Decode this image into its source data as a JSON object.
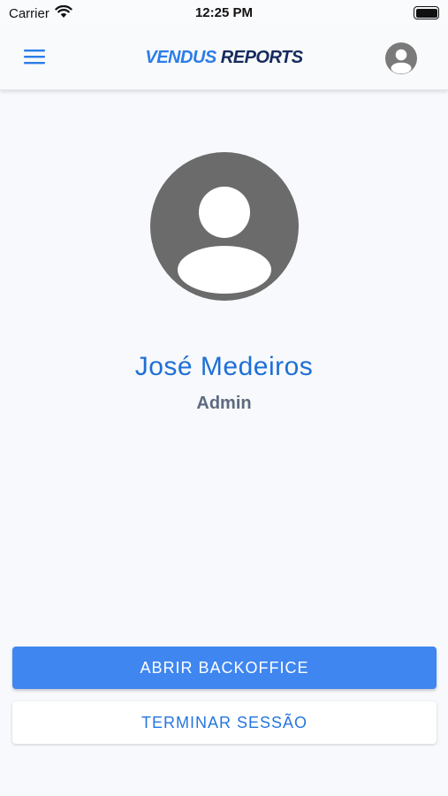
{
  "status_bar": {
    "carrier": "Carrier",
    "time": "12:25 PM"
  },
  "header": {
    "brand_part1": "VENDUS",
    "brand_part2": "REPORTS",
    "menu_icon": "hamburger-icon",
    "profile_icon": "account-circle-icon"
  },
  "profile": {
    "avatar_icon": "account-circle-icon",
    "name": "José Medeiros",
    "role": "Admin"
  },
  "actions": {
    "open_backoffice": "ABRIR BACKOFFICE",
    "end_session": "TERMINAR SESSÃO"
  },
  "colors": {
    "accent": "#3f86f0",
    "name_text": "#1f6fd6",
    "brand_dark": "#152a5e",
    "avatar_gray": "#6b6b6b"
  }
}
